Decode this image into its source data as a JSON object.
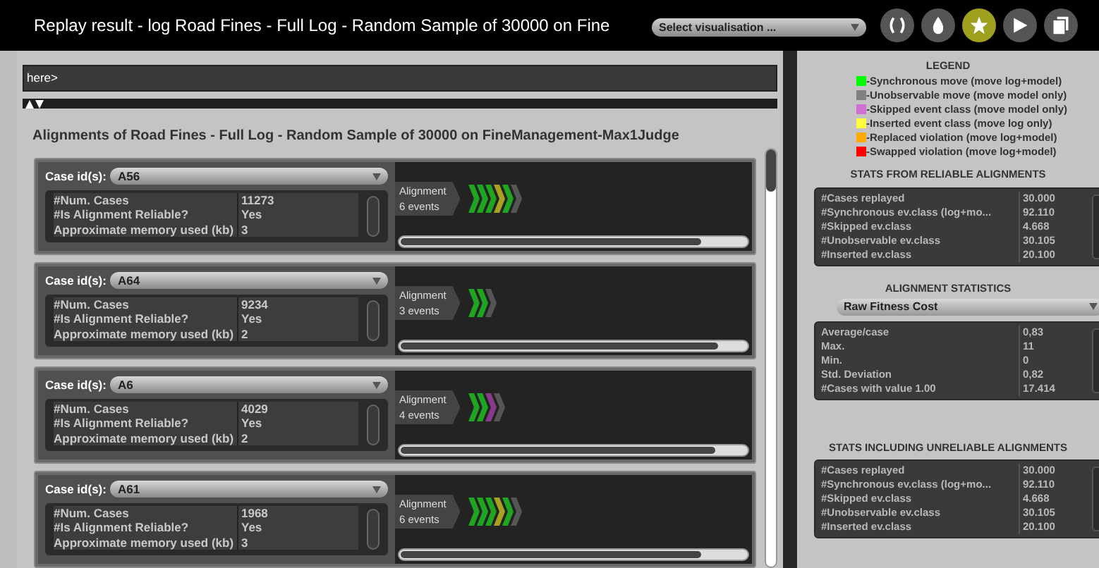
{
  "window": {
    "title": "Replay result - log Road Fines - Full Log - Random Sample of 30000 on Fine"
  },
  "visualisation_select": {
    "value": "Select visualisation ..."
  },
  "toolbar": [
    {
      "kind": "brackets",
      "selected": false
    },
    {
      "kind": "drop",
      "selected": false
    },
    {
      "kind": "star",
      "selected": true
    },
    {
      "kind": "play",
      "selected": false
    },
    {
      "kind": "copy",
      "selected": false
    }
  ],
  "query": {
    "value": "here>"
  },
  "heading": "Alignments of Road Fines - Full Log - Random Sample of 30000 on FineManagement-Max1Judge",
  "alignments": [
    {
      "case_label": "Case id(s):",
      "case_id": "A56",
      "rows": [
        [
          "#Num. Cases",
          "11273"
        ],
        [
          "#Is Alignment Reliable?",
          "Yes"
        ],
        [
          "Approximate memory used (kb)",
          "3"
        ]
      ],
      "tag": "Alignment",
      "events_text": "6 events",
      "events": [
        {
          "color": "#1fa51f"
        },
        {
          "color": "#1fa51f"
        },
        {
          "color": "#1fa51f"
        },
        {
          "color": "#a8a020"
        },
        {
          "color": "#1fa51f"
        },
        {
          "color": "#555555"
        }
      ],
      "level": 0.87
    },
    {
      "case_label": "Case id(s):",
      "case_id": "A64",
      "rows": [
        [
          "#Num. Cases",
          "9234"
        ],
        [
          "#Is Alignment Reliable?",
          "Yes"
        ],
        [
          "Approximate memory used (kb)",
          "2"
        ]
      ],
      "tag": "Alignment",
      "events_text": "3 events",
      "events": [
        {
          "color": "#1fa51f"
        },
        {
          "color": "#1fa51f"
        },
        {
          "color": "#555555"
        }
      ],
      "level": 0.92
    },
    {
      "case_label": "Case id(s):",
      "case_id": "A6",
      "rows": [
        [
          "#Num. Cases",
          "4029"
        ],
        [
          "#Is Alignment Reliable?",
          "Yes"
        ],
        [
          "Approximate memory used (kb)",
          "2"
        ]
      ],
      "tag": "Alignment",
      "events_text": "4 events",
      "events": [
        {
          "color": "#1fa51f"
        },
        {
          "color": "#1fa51f"
        },
        {
          "color": "#8a3a8a"
        },
        {
          "color": "#555555"
        }
      ],
      "level": 0.91
    },
    {
      "case_label": "Case id(s):",
      "case_id": "A61",
      "rows": [
        [
          "#Num. Cases",
          "1968"
        ],
        [
          "#Is Alignment Reliable?",
          "Yes"
        ],
        [
          "Approximate memory used (kb)",
          "3"
        ]
      ],
      "tag": "Alignment",
      "events_text": "6 events",
      "events": [
        {
          "color": "#1fa51f"
        },
        {
          "color": "#1fa51f"
        },
        {
          "color": "#1fa51f"
        },
        {
          "color": "#a8a020"
        },
        {
          "color": "#1fa51f"
        },
        {
          "color": "#555555"
        }
      ],
      "level": 0.87
    }
  ],
  "legend": {
    "title": "LEGEND",
    "items": [
      {
        "label": "-Synchronous move (move log+model)",
        "color": "#00ff00"
      },
      {
        "label": "-Unobservable move (move model only)",
        "color": "#808080"
      },
      {
        "label": "-Skipped event class (move model only)",
        "color": "#d070d0"
      },
      {
        "label": "-Inserted event class (move log only)",
        "color": "#ffff40"
      },
      {
        "label": "-Replaced violation (move log+model)",
        "color": "#ffaa00"
      },
      {
        "label": "-Swapped violation (move log+model)",
        "color": "#ff0000"
      }
    ]
  },
  "reliable_stats": {
    "title": "STATS FROM RELIABLE ALIGNMENTS",
    "rows": [
      [
        "#Cases replayed",
        "30.000"
      ],
      [
        "#Synchronous ev.class (log+mo...",
        "92.110"
      ],
      [
        "#Skipped ev.class",
        "4.668"
      ],
      [
        "#Unobservable ev.class",
        "30.105"
      ],
      [
        "#Inserted ev.class",
        "20.100"
      ]
    ]
  },
  "alignment_statistics": {
    "title": "ALIGNMENT STATISTICS",
    "select": "Raw Fitness Cost",
    "rows": [
      [
        "Average/case",
        "0,83"
      ],
      [
        "Max.",
        "11"
      ],
      [
        "Min.",
        "0"
      ],
      [
        "Std. Deviation",
        "0,82"
      ],
      [
        "#Cases with value 1.00",
        "17.414"
      ]
    ]
  },
  "unreliable_stats": {
    "title": "STATS INCLUDING UNRELIABLE ALIGNMENTS",
    "rows": [
      [
        "#Cases replayed",
        "30.000"
      ],
      [
        "#Synchronous ev.class (log+mo...",
        "92.110"
      ],
      [
        "#Skipped ev.class",
        "4.668"
      ],
      [
        "#Unobservable ev.class",
        "30.105"
      ],
      [
        "#Inserted ev.class",
        "20.100"
      ]
    ]
  }
}
